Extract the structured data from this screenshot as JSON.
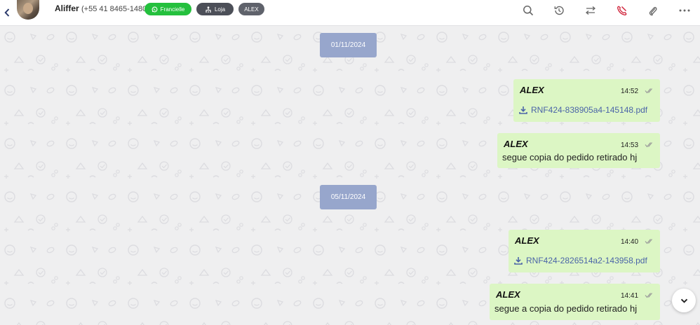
{
  "header": {
    "contact_name": "Aliffer",
    "contact_phone": "(+55 41 8465-1480)",
    "tags": [
      {
        "label": "Francielle",
        "icon": "whatsapp-icon",
        "color": "#24c03d"
      },
      {
        "label": "Loja",
        "icon": "store-network-icon",
        "color": "#4c4f58"
      },
      {
        "label": "ALEX",
        "icon": "",
        "color": "#5f626b"
      }
    ],
    "actions": [
      "search-icon",
      "history-icon",
      "transfer-icon",
      "end-call-icon",
      "attach-icon",
      "more-icon"
    ]
  },
  "chat": {
    "dates": [
      "01/11/2024",
      "05/11/2024"
    ],
    "messages": [
      {
        "sender": "ALEX",
        "time": "14:52",
        "type": "file",
        "content": "RNF424-838905a4-145148.pdf"
      },
      {
        "sender": "ALEX",
        "time": "14:53",
        "type": "text",
        "content": "segue copia do pedido retirado hj"
      },
      {
        "sender": "ALEX",
        "time": "14:40",
        "type": "file",
        "content": "RNF424-2826514a2-143958.pdf"
      },
      {
        "sender": "ALEX",
        "time": "14:41",
        "type": "text",
        "content": "segue a copia do pedido retirado hj"
      }
    ]
  },
  "colors": {
    "bubble": "#dcf6c4",
    "date_pill": "#97a6cc",
    "file_link": "#4a64a8",
    "end_call": "#d0233a"
  }
}
